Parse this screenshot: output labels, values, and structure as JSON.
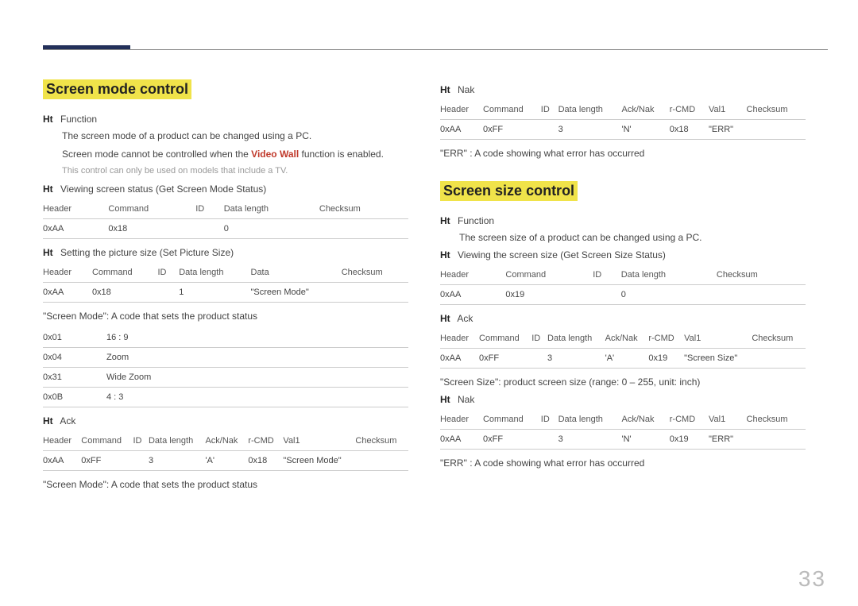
{
  "page_number": "33",
  "left": {
    "section_title": "Screen mode control",
    "ht_function": "Function",
    "function_desc1": "The screen mode of a product can be changed using a PC.",
    "function_desc2a": "Screen mode cannot be controlled when the ",
    "function_desc2b": "Video Wall",
    "function_desc2c": " function is enabled.",
    "note": "This control can only be used on models that include a TV.",
    "ht_viewing": "Viewing screen status (Get Screen Mode Status)",
    "table1": {
      "headers": [
        "Header",
        "Command",
        "ID",
        "Data length",
        "Checksum"
      ],
      "row": [
        "0xAA",
        "0x18",
        "",
        "0",
        ""
      ]
    },
    "ht_setting": "Setting the picture size (Set Picture Size)",
    "table2": {
      "headers": [
        "Header",
        "Command",
        "ID",
        "Data length",
        "Data",
        "Checksum"
      ],
      "row": [
        "0xAA",
        "0x18",
        "",
        "1",
        "\"Screen Mode\"",
        ""
      ]
    },
    "caption_modes": "\"Screen Mode\": A code that sets the product status",
    "modes": [
      {
        "code": "0x01",
        "label": "16 : 9"
      },
      {
        "code": "0x04",
        "label": "Zoom"
      },
      {
        "code": "0x31",
        "label": "Wide Zoom"
      },
      {
        "code": "0x0B",
        "label": "4 : 3"
      }
    ],
    "ht_ack": "Ack",
    "table3": {
      "headers": [
        "Header",
        "Command",
        "ID",
        "Data length",
        "Ack/Nak",
        "r-CMD",
        "Val1",
        "Checksum"
      ],
      "row": [
        "0xAA",
        "0xFF",
        "",
        "3",
        "'A'",
        "0x18",
        "\"Screen Mode\"",
        ""
      ]
    },
    "caption_ack": "\"Screen Mode\": A code that sets the product status"
  },
  "right_top": {
    "ht_nak": "Nak",
    "table_nak": {
      "headers": [
        "Header",
        "Command",
        "ID",
        "Data length",
        "Ack/Nak",
        "r-CMD",
        "Val1",
        "Checksum"
      ],
      "row": [
        "0xAA",
        "0xFF",
        "",
        "3",
        "'N'",
        "0x18",
        "\"ERR\"",
        ""
      ]
    },
    "err_caption": "\"ERR\" : A code showing what error has occurred"
  },
  "size": {
    "section_title": "Screen size control",
    "ht_function": "Function",
    "function_desc": "The screen size of a product can be changed using a PC.",
    "ht_viewing": "Viewing the screen size (Get Screen Size Status)",
    "table1": {
      "headers": [
        "Header",
        "Command",
        "ID",
        "Data length",
        "Checksum"
      ],
      "row": [
        "0xAA",
        "0x19",
        "",
        "0",
        ""
      ]
    },
    "ht_ack": "Ack",
    "table2": {
      "headers": [
        "Header",
        "Command",
        "ID",
        "Data length",
        "Ack/Nak",
        "r-CMD",
        "Val1",
        "Checksum"
      ],
      "row": [
        "0xAA",
        "0xFF",
        "",
        "3",
        "'A'",
        "0x19",
        "\"Screen Size\"",
        ""
      ]
    },
    "caption_size": "\"Screen Size\": product screen size (range: 0 – 255, unit: inch)",
    "ht_nak": "Nak",
    "table3": {
      "headers": [
        "Header",
        "Command",
        "ID",
        "Data length",
        "Ack/Nak",
        "r-CMD",
        "Val1",
        "Checksum"
      ],
      "row": [
        "0xAA",
        "0xFF",
        "",
        "3",
        "'N'",
        "0x19",
        "\"ERR\"",
        ""
      ]
    },
    "err_caption": "\"ERR\" : A code showing what error has occurred"
  }
}
